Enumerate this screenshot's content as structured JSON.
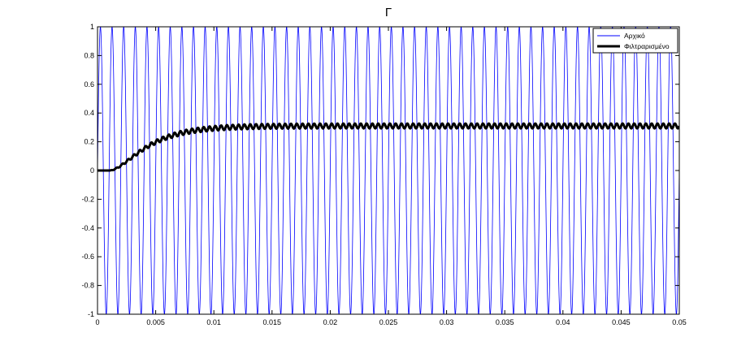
{
  "chart_data": {
    "type": "line",
    "title": "Γ",
    "xlabel": "",
    "ylabel": "",
    "xlim": [
      0,
      0.05
    ],
    "ylim": [
      -1,
      1
    ],
    "xticks": [
      0,
      0.005,
      0.01,
      0.015,
      0.02,
      0.025,
      0.03,
      0.035,
      0.04,
      0.045,
      0.05
    ],
    "xtick_labels": [
      "0",
      "0.005",
      "0.01",
      "0.015",
      "0.02",
      "0.025",
      "0.03",
      "0.035",
      "0.04",
      "0.045",
      "0.05"
    ],
    "yticks": [
      -1,
      -0.8,
      -0.6,
      -0.4,
      -0.2,
      0,
      0.2,
      0.4,
      0.6,
      0.8,
      1
    ],
    "ytick_labels": [
      "-1",
      "-0.8",
      "-0.6",
      "-0.4",
      "-0.2",
      "0",
      "0.2",
      "0.4",
      "0.6",
      "0.8",
      "1"
    ],
    "grid": false,
    "legend_position": "top-right",
    "series": [
      {
        "name": "Αρχικό",
        "color": "#0000ff",
        "kind": "sine",
        "amplitude": 1,
        "frequency_hz": 1000,
        "phase_deg": 0
      },
      {
        "name": "Φιλτραρισμένο",
        "color": "#000000",
        "kind": "filtered_response",
        "delay": 0.001,
        "steady_level": 0.31,
        "settling_time": 0.009,
        "ripple_amplitude": 0.017,
        "ripple_frequency_hz": 2000
      }
    ]
  }
}
